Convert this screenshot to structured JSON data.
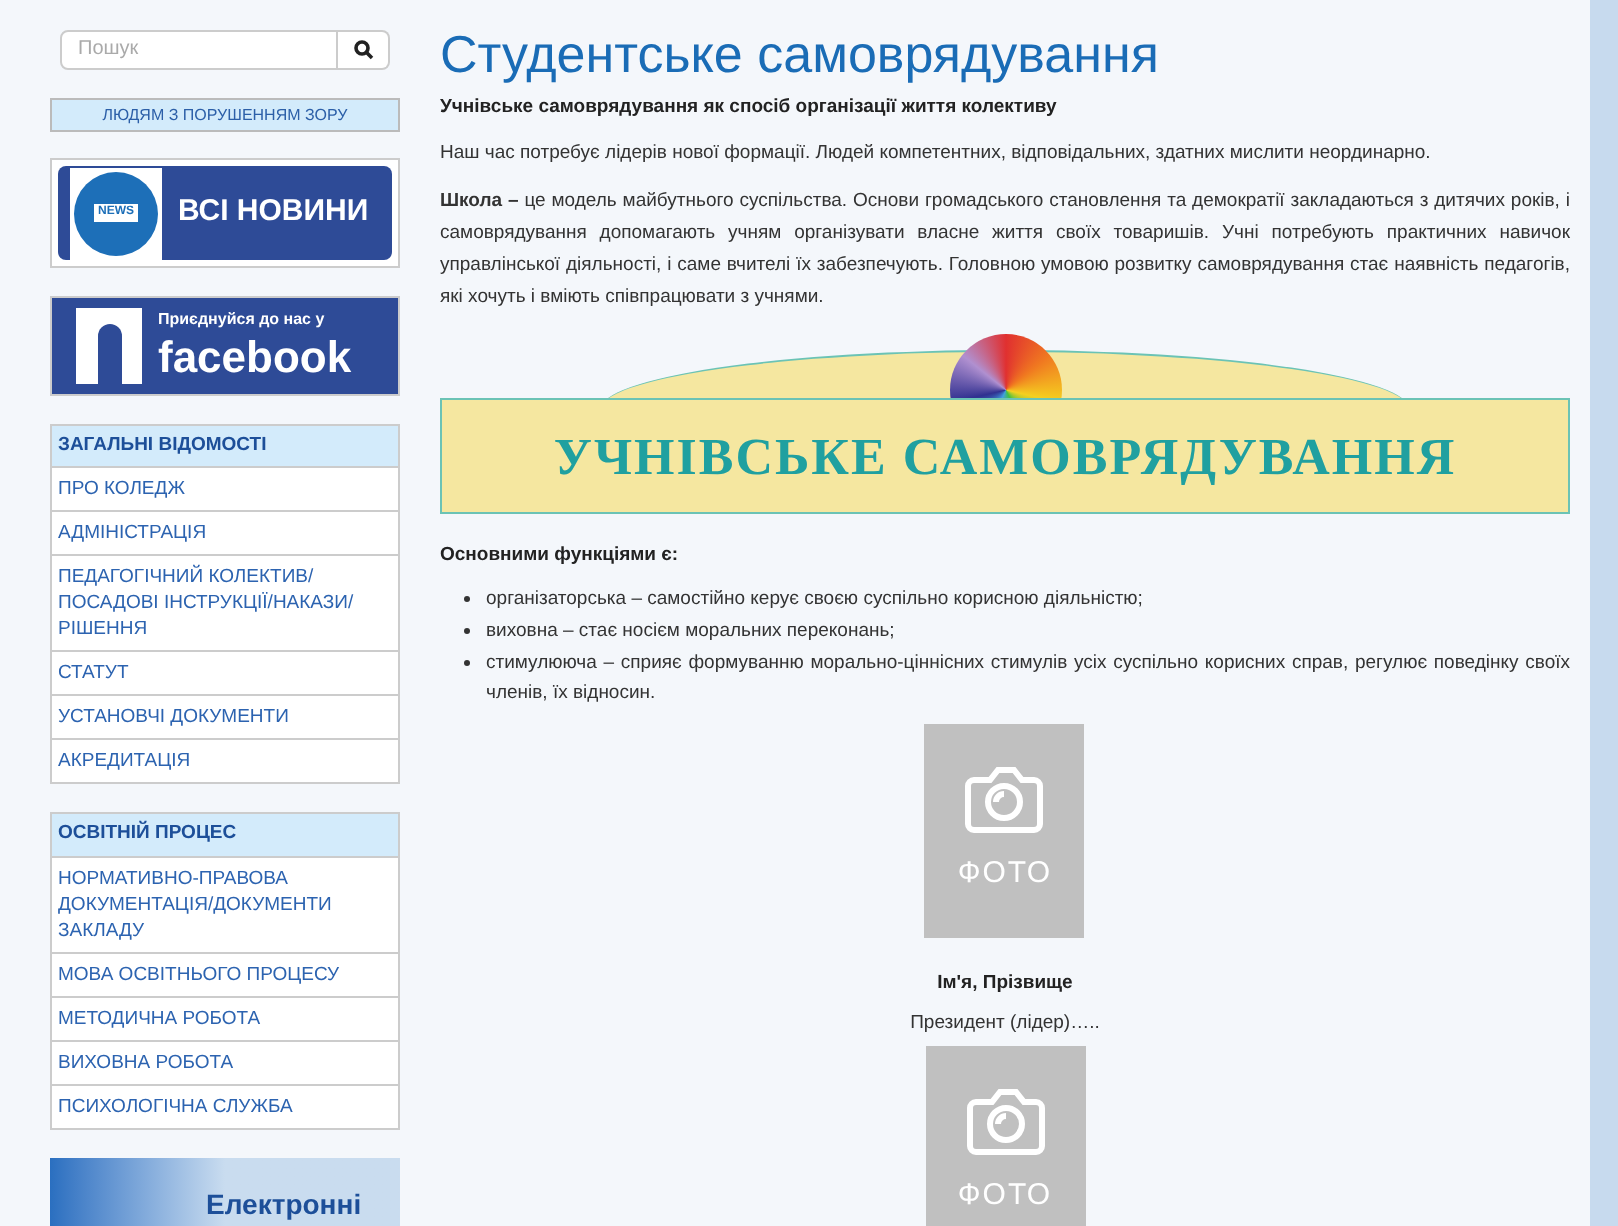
{
  "sidebar": {
    "search": {
      "placeholder": "Пошук"
    },
    "accessibility_button": "ЛЮДЯМ З ПОРУШЕННЯМ ЗОРУ",
    "news_banner": {
      "badge": "NEWS",
      "label": "ВСІ НОВИНИ"
    },
    "facebook_banner": {
      "caption": "Приєднуйся до нас у",
      "label": "facebook"
    },
    "menus": [
      {
        "title": "ЗАГАЛЬНІ ВІДОМОСТІ",
        "items": [
          "ПРО КОЛЕДЖ",
          "АДМІНІСТРАЦІЯ",
          "ПЕДАГОГІЧНИЙ КОЛЕКТИВ/ ПОСАДОВІ ІНСТРУКЦІЇ/НАКАЗИ/ РІШЕННЯ",
          "СТАТУТ",
          "УСТАНОВЧІ ДОКУМЕНТИ",
          "АКРЕДИТАЦІЯ"
        ]
      },
      {
        "title": "ОСВІТНІЙ ПРОЦЕС",
        "items": [
          "НОРМАТИВНО-ПРАВОВА ДОКУМЕНТАЦІЯ/ДОКУМЕНТИ ЗАКЛАДУ",
          "МОВА ОСВІТНЬОГО ПРОЦЕСУ",
          "МЕТОДИЧНА РОБОТА",
          "ВИХОВНА РОБОТА",
          "ПСИХОЛОГІЧНА СЛУЖБА"
        ]
      }
    ],
    "bottom_banner": "Електронні"
  },
  "article": {
    "title": "Студентське самоврядування",
    "subtitle": "Учнівське самоврядування як спосіб організації життя колективу",
    "paragraphs": [
      "Наш час потребує лідерів нової формації. Людей компетентних, відповідальних, здатних мислити неординарно.",
      "**Школа –** це модель майбутнього суспільства. Основи громадського становлення та демократії закладаються з дитячих років, і самоврядування допомагають учням організувати власне життя своїх товаришів. Учні потребують практичних навичок управлінської діяльності, і саме вчителі їх забезпечують. Головною умовою розвитку самоврядування стає наявність педагогів, які хочуть і вміють співпрацювати з учнями."
    ],
    "banner_text": "УЧНІВСЬКЕ САМОВРЯДУВАННЯ",
    "functions_heading": "Основними функціями є:",
    "functions": [
      "організаторська – самостійно керує своєю суспільно корисною діяльністю;",
      "виховна – стає носієм моральних переконань;",
      "стимулююча – сприяє формуванню морально-ціннісних стимулів усіх суспільно корисних справ, регулює поведінку своїх членів, їх відносин."
    ],
    "members": [
      {
        "photo_label": "ФОТО",
        "name": "Ім'я, Прізвище",
        "role": "Президент (лідер)….."
      },
      {
        "photo_label": "ФОТО"
      }
    ]
  }
}
